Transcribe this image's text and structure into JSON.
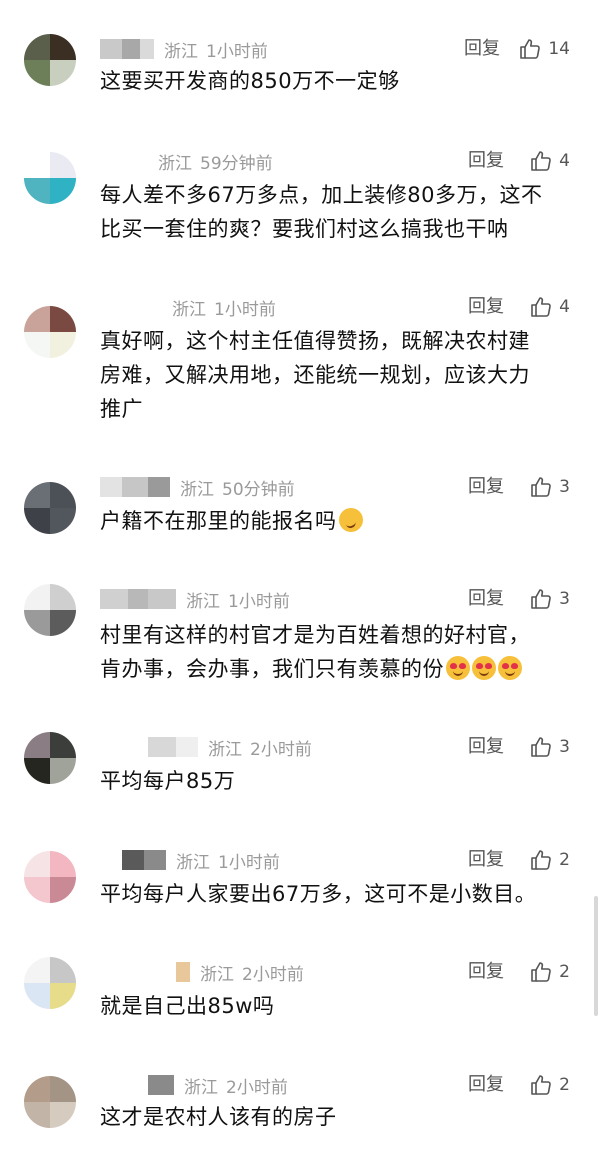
{
  "reply_label": "回复",
  "comments": [
    {
      "location": "浙江",
      "time": "1小时前",
      "likes": "14",
      "lines": [
        "这要买开发商的850万不一定够"
      ]
    },
    {
      "location": "浙江",
      "time": "59分钟前",
      "likes": "4",
      "lines": [
        "每人差不多67万多点，加上装修80多万，这不",
        "比买一套住的爽？要我们村这么搞我也干呐"
      ]
    },
    {
      "location": "浙江",
      "time": "1小时前",
      "likes": "4",
      "lines": [
        "真好啊，这个村主任值得赞扬，既解决农村建",
        "房难，又解决用地，还能统一规划，应该大力",
        "推广"
      ]
    },
    {
      "location": "浙江",
      "time": "50分钟前",
      "likes": "3",
      "lines": [
        "户籍不在那里的能报名吗"
      ],
      "emoji": "thinking-face-emoji"
    },
    {
      "location": "浙江",
      "time": "1小时前",
      "likes": "3",
      "lines": [
        "村里有这样的村官才是为百姓着想的好村官，",
        "肯办事，会办事，我们只有羡慕的份"
      ],
      "emoji": "heart-eyes-emoji x3"
    },
    {
      "location": "浙江",
      "time": "2小时前",
      "likes": "3",
      "lines": [
        "平均每户85万"
      ]
    },
    {
      "location": "浙江",
      "time": "1小时前",
      "likes": "2",
      "lines": [
        "平均每户人家要出67万多，这可不是小数目。"
      ]
    },
    {
      "location": "浙江",
      "time": "2小时前",
      "likes": "2",
      "lines": [
        "就是自己出85w吗"
      ]
    },
    {
      "location": "浙江",
      "time": "2小时前",
      "likes": "2",
      "lines": [
        "这才是农村人该有的房子"
      ]
    }
  ],
  "colors": {
    "meta": "#9a9a9a",
    "text": "#111111",
    "action": "#555555"
  }
}
